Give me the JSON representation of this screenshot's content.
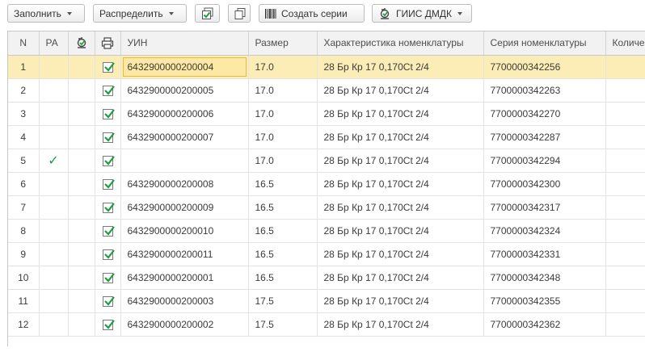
{
  "toolbar": {
    "fill_label": "Заполнить",
    "distribute_label": "Распределить",
    "create_series_label": "Создать серии",
    "giis_label": "ГИИС ДМДК"
  },
  "table": {
    "columns": [
      "N",
      "РА",
      "",
      "",
      "УИН",
      "Размер",
      "Характеристика номенклатуры",
      "Серия номенклатуры",
      "Количес"
    ],
    "rows": [
      {
        "n": "1",
        "ra": "",
        "checked": true,
        "uin": "6432900000200004",
        "size": "17.0",
        "char": "28 Бр Кр 17 0,170Ct 2/4",
        "series": "7700000342256"
      },
      {
        "n": "2",
        "ra": "",
        "checked": true,
        "uin": "6432900000200005",
        "size": "17.0",
        "char": "28 Бр Кр 17 0,170Ct 2/4",
        "series": "7700000342263"
      },
      {
        "n": "3",
        "ra": "",
        "checked": true,
        "uin": "6432900000200006",
        "size": "17.0",
        "char": "28 Бр Кр 17 0,170Ct 2/4",
        "series": "7700000342270"
      },
      {
        "n": "4",
        "ra": "",
        "checked": true,
        "uin": "6432900000200007",
        "size": "17.0",
        "char": "28 Бр Кр 17 0,170Ct 2/4",
        "series": "7700000342287"
      },
      {
        "n": "5",
        "ra": "✓",
        "checked": true,
        "uin": "",
        "size": "17.0",
        "char": "28 Бр Кр 17 0,170Ct 2/4",
        "series": "7700000342294"
      },
      {
        "n": "6",
        "ra": "",
        "checked": true,
        "uin": "6432900000200008",
        "size": "16.5",
        "char": "28 Бр Кр 17 0,170Ct 2/4",
        "series": "7700000342300"
      },
      {
        "n": "7",
        "ra": "",
        "checked": true,
        "uin": "6432900000200009",
        "size": "16.5",
        "char": "28 Бр Кр 17 0,170Ct 2/4",
        "series": "7700000342317"
      },
      {
        "n": "8",
        "ra": "",
        "checked": true,
        "uin": "6432900000200010",
        "size": "16.5",
        "char": "28 Бр Кр 17 0,170Ct 2/4",
        "series": "7700000342324"
      },
      {
        "n": "9",
        "ra": "",
        "checked": true,
        "uin": "6432900000200011",
        "size": "16.5",
        "char": "28 Бр Кр 17 0,170Ct 2/4",
        "series": "7700000342331"
      },
      {
        "n": "10",
        "ra": "",
        "checked": true,
        "uin": "6432900000200001",
        "size": "16.5",
        "char": "28 Бр Кр 17 0,170Ct 2/4",
        "series": "7700000342348"
      },
      {
        "n": "11",
        "ra": "",
        "checked": true,
        "uin": "6432900000200003",
        "size": "17.5",
        "char": "28 Бр Кр 17 0,170Ct 2/4",
        "series": "7700000342355"
      },
      {
        "n": "12",
        "ra": "",
        "checked": true,
        "uin": "6432900000200002",
        "size": "17.5",
        "char": "28 Бр Кр 17 0,170Ct 2/4",
        "series": "7700000342362"
      }
    ],
    "selected_row": 0
  },
  "icons": {
    "copy_checked": "copy-checked-icon",
    "copy": "copy-icon",
    "barcode": "barcode-icon",
    "giis": "giis-stamp-icon",
    "printer": "printer-icon"
  },
  "colors": {
    "selected_row": "#fbedb5",
    "selected_cell_border": "#e7b93c",
    "check_green": "#1b9e3e",
    "header_bg": "#f2f2f2"
  }
}
